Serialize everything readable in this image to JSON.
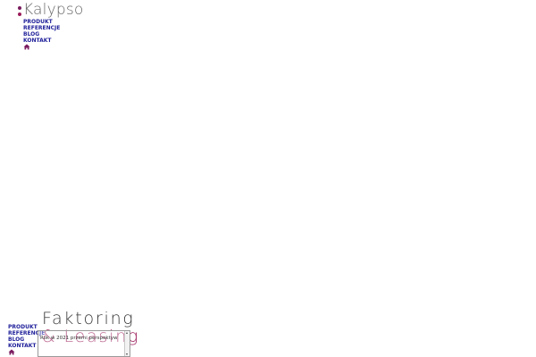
{
  "brand": {
    "logo_text": "Kalypso",
    "dot_colors": [
      "#7a1a5e",
      "#9b1c5a"
    ]
  },
  "nav_top": {
    "items": [
      {
        "label": "PRODUKT"
      },
      {
        "label": "REFERENCJE"
      },
      {
        "label": "BLOG"
      },
      {
        "label": "KONTAKT"
      }
    ],
    "home_icon": "home-icon"
  },
  "nav_bottom": {
    "items": [
      {
        "label": "PRODUKT"
      },
      {
        "label": "REFERENCJE"
      },
      {
        "label": "BLOG"
      },
      {
        "label": "KONTAKT"
      }
    ],
    "home_icon": "home-icon"
  },
  "banner": {
    "line1": "Faktoring",
    "line2": "& Leasing"
  },
  "select": {
    "value": "Rok w 2021 przemi perspektyw"
  },
  "colors": {
    "nav_link": "#1e1e9a",
    "banner_dark": "#3a3a3a",
    "banner_accent": "#9b1c5a",
    "logo_text": "#666666"
  }
}
